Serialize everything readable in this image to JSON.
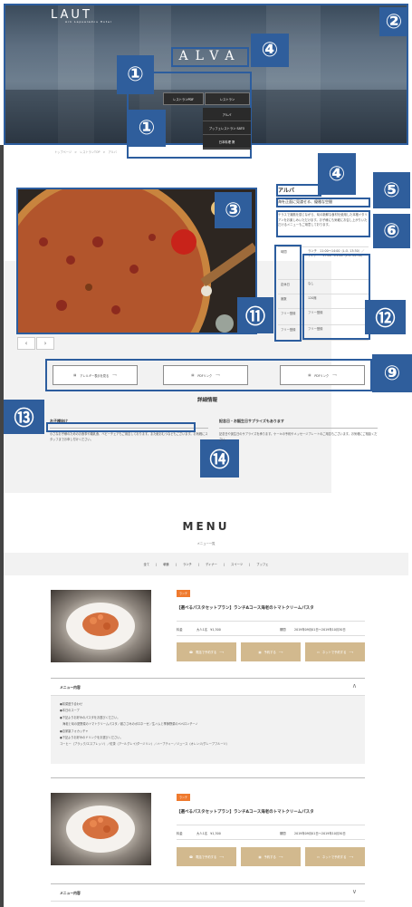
{
  "logo": {
    "title": "LAUT",
    "subtitle": "Ark Lapsalamis Hotel"
  },
  "hero": {
    "title": "ALVA",
    "btn_pdf": "レストランPDF",
    "btn_restaurant": "レストラン",
    "dropdown": [
      "アルバ",
      "ブッフェレストラン SATO",
      "日本料理 葵"
    ]
  },
  "breadcrumb": "トップページ　>　レストランTOP　>　アルバ",
  "annotations": [
    "①",
    "②",
    "③",
    "④",
    "⑤",
    "⑥",
    "⑨",
    "⑪",
    "⑫",
    "⑬",
    "⑭"
  ],
  "restaurant": {
    "name": "アルバ",
    "tagline": "海を正面に見渡せる、優雅な空間",
    "description": "テラスで潮風を感じながら、旬の新鮮な食材を使用した本格イタリアンをお楽しみいただけます。お子様にも気軽にお召し上がりいただけるメニューもご用意しております。",
    "info": [
      {
        "key": "時間",
        "value": "ランチ　11:00〜14:00（L.O. 13:30）／ディナー　17:00〜21:00（L.O. 20:30）"
      },
      {
        "key": "定休日",
        "value": "なし"
      },
      {
        "key": "席数",
        "value": "120席"
      },
      {
        "key": "フリー登録",
        "value": "フリー登録"
      },
      {
        "key": "フリー登録",
        "value": "フリー登録"
      }
    ]
  },
  "links": [
    "アレルギー表示を見る",
    "PDFリンク",
    "PDFリンク"
  ],
  "details": {
    "title": "詳細情報",
    "left": {
      "heading": "お子様向け",
      "body": "小さなお子様のためのお食事や離乳食、ベビーチェアもご用意しております。また紙おむつなどもございます。お気軽にスタッフまでお申し付けください。"
    },
    "right": {
      "heading": "記念日・お誕生日サプライズもあります",
      "body": "記念日や誕生日のサプライズを承ります。ケーキの予約やメッセージプレートのご用意もございます。お気軽にご相談ください。"
    }
  },
  "menu": {
    "title": "MENU",
    "subtitle": "メニュー一覧",
    "filters": [
      "全て",
      "朝食",
      "ランチ",
      "ディナー",
      "スイーツ",
      "ブッフェ"
    ]
  },
  "cards": [
    {
      "tag": "ランチ",
      "title": "【選べるパスタセットプラン】ランチAコース海老のトマトクリームパスタ",
      "price_label": "料金",
      "price": "大人1名　¥1,300",
      "period_label": "期間",
      "period": "2019年09月01日〜2019年10月30日",
      "buttons": [
        "電話で予約する",
        "予約する",
        "ネットで予約する"
      ],
      "accordion": "メニュー内容",
      "accordion_icon": "∧",
      "contents": [
        "●前菜盛り合わせ",
        "●本日のスープ",
        "●下記よりお好みのパスタをお選びください。",
        "　海老と旬の夏野菜のトマトクリームパスタ／鶏ささみのボロネーゼ／生ハムと季節野菜のペペロンチーノ",
        "●自家製フォカッチャ",
        "●下記よりお好みのドリンクをお選びください。",
        "コーヒー（ブラック/エスプレッソ）／紅茶（アールグレイ/ダージリン）／ハーブティー／ジュース（オレンジ/グレープフルーツ）"
      ]
    },
    {
      "tag": "ランチ",
      "title": "【選べるパスタセットプラン】ランチAコース海老のトマトクリームパスタ",
      "price_label": "料金",
      "price": "大人1名　¥1,300",
      "period_label": "期間",
      "period": "2019年09月01日〜2019年10月30日",
      "buttons": [
        "電話で予約する",
        "予約する",
        "ネットで予約する"
      ],
      "accordion": "メニュー内容",
      "accordion_icon": "∨"
    }
  ]
}
